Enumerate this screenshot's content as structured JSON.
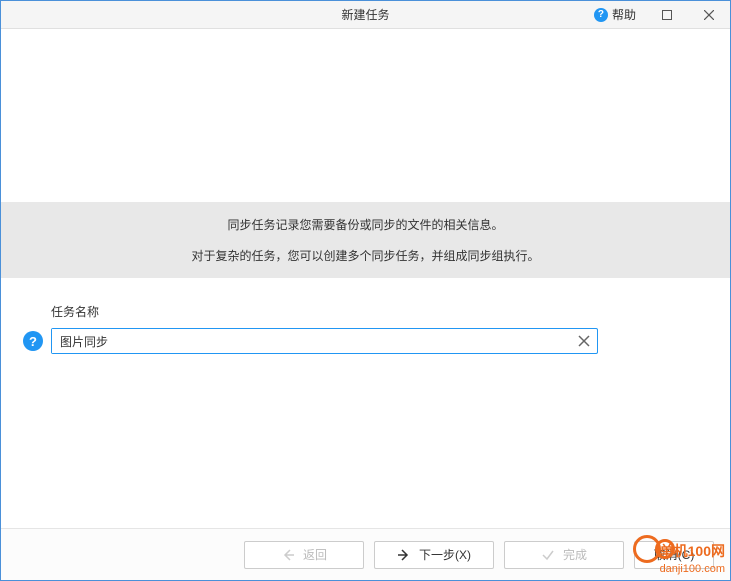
{
  "titlebar": {
    "title": "新建任务",
    "help_label": "帮助"
  },
  "info": {
    "line1": "同步任务记录您需要备份或同步的文件的相关信息。",
    "line2": "对于复杂的任务，您可以创建多个同步任务，并组成同步组执行。"
  },
  "form": {
    "label": "任务名称",
    "value": "图片同步"
  },
  "footer": {
    "back": "返回",
    "next": "下一步(X)",
    "finish": "完成",
    "cancel": "取消(C)"
  },
  "watermark": {
    "text": "单机100网",
    "sub": "danji100.com"
  }
}
